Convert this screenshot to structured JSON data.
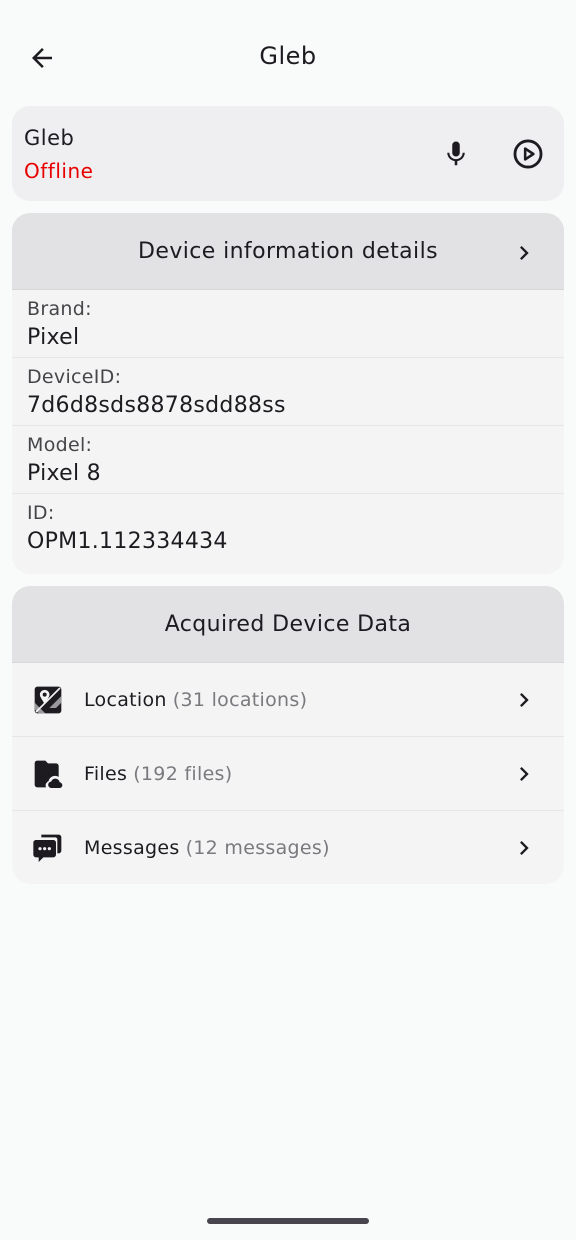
{
  "header": {
    "title": "Gleb",
    "back_icon": "arrow-back-icon"
  },
  "user": {
    "name": "Gleb",
    "status": "Offline",
    "status_color": "#e80000",
    "actions": [
      {
        "icon": "microphone-icon"
      },
      {
        "icon": "play-circle-icon"
      }
    ]
  },
  "device_info": {
    "title": "Device information details",
    "rows": [
      {
        "label": "Brand:",
        "value": "Pixel"
      },
      {
        "label": "DeviceID:",
        "value": "7d6d8sds8878sdd88ss"
      },
      {
        "label": "Model:",
        "value": "Pixel 8"
      },
      {
        "label": "ID:",
        "value": "OPM1.112334434"
      }
    ]
  },
  "acquired": {
    "title": "Acquired Device Data",
    "items": [
      {
        "label": "Location",
        "count": "(31 locations)",
        "icon": "location-map-icon"
      },
      {
        "label": "Files",
        "count": "(192 files)",
        "icon": "cloud-folder-icon"
      },
      {
        "label": "Messages",
        "count": "(12 messages)",
        "icon": "chat-bubbles-icon"
      }
    ]
  }
}
